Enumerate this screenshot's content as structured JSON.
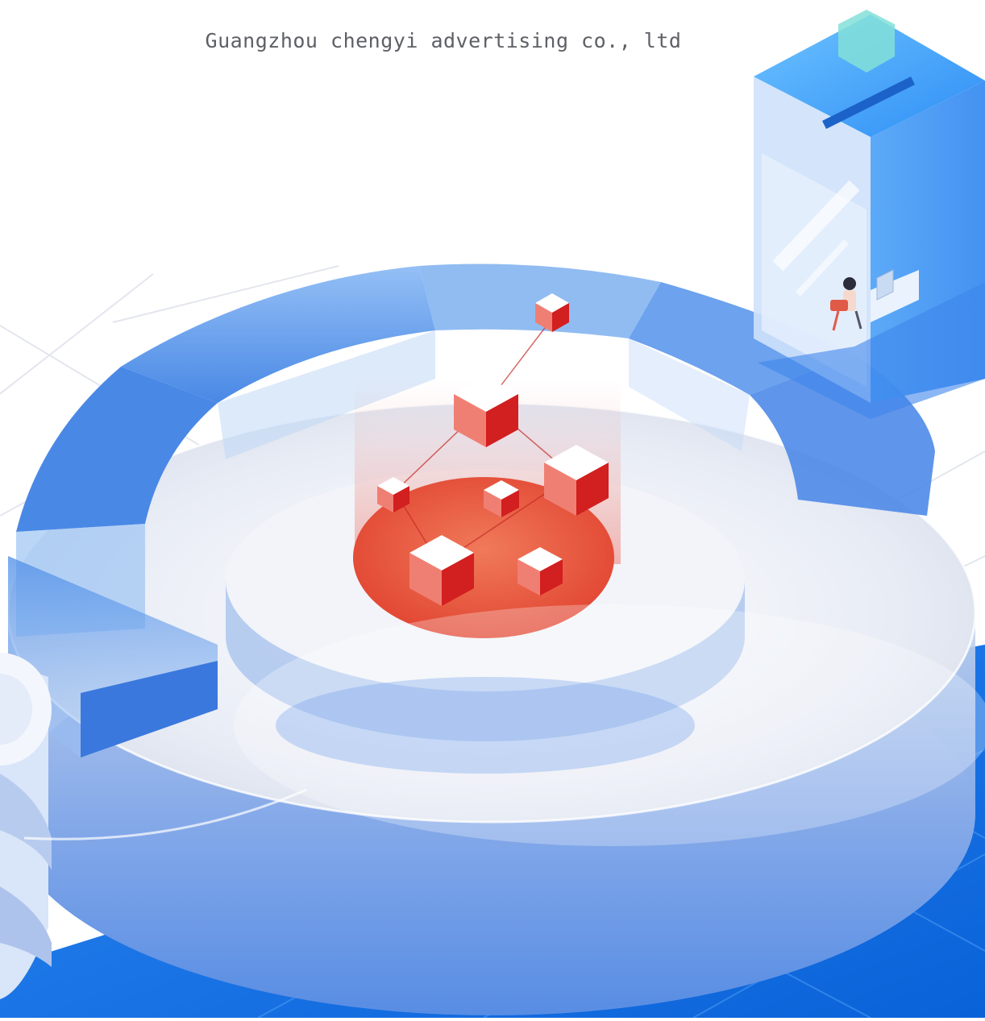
{
  "caption": "Guangzhou chengyi advertising co., ltd",
  "colors": {
    "background": "#ffffff",
    "floor_blue": "#0a6fe8",
    "ring_blue": "#3d82e6",
    "platform_white": "#eef1f8",
    "cube_red": "#e0322c",
    "glow_red": "#ee5a3a",
    "caption_text": "#5e6066"
  },
  "icons": [
    "isometric-ring-icon",
    "red-cube-icon",
    "booth-tower-icon",
    "person-at-desk-icon",
    "disc-stack-icon"
  ]
}
